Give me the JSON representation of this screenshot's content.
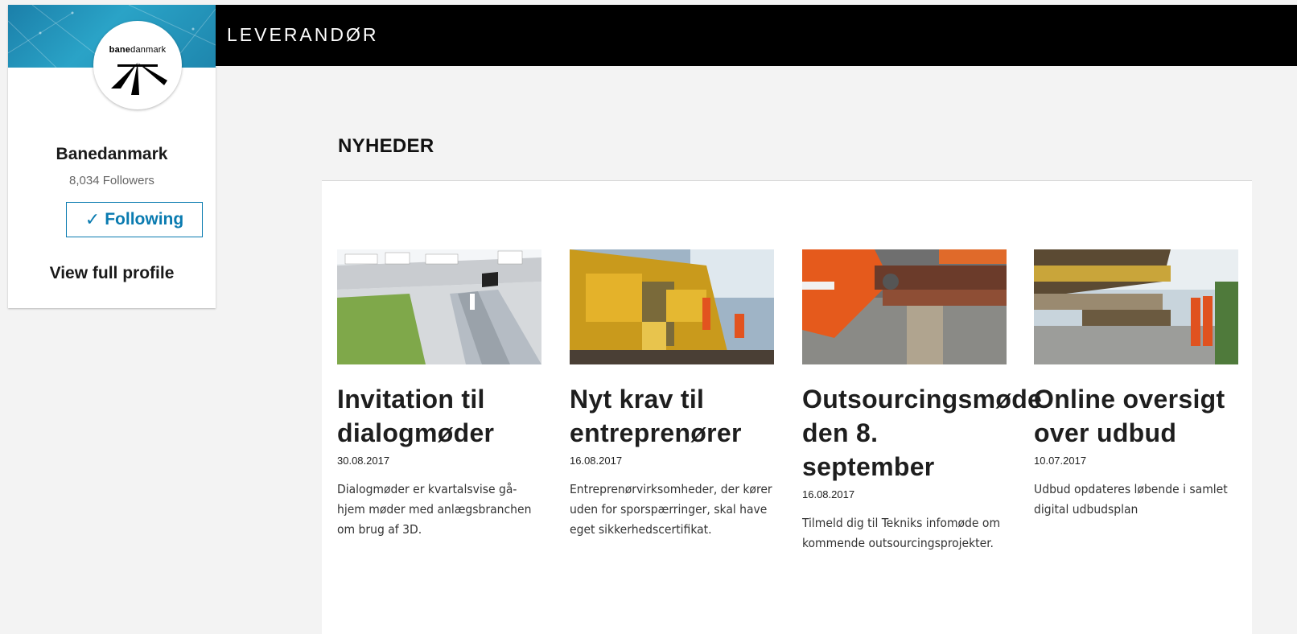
{
  "header": {
    "title": "LEVERANDØR"
  },
  "profile": {
    "logo_text_bold": "bane",
    "logo_text_regular": "danmark",
    "name": "Banedanmark",
    "followers": "8,034 Followers",
    "follow_button": {
      "check": "✓",
      "label": "Following"
    },
    "view_profile": "View full profile",
    "banner_color": "#1e8fb8"
  },
  "news": {
    "section_title": "NYHEDER",
    "items": [
      {
        "title": "Invitation til dialogmøder",
        "date": "30.08.2017",
        "text": "Dialogmøder er kvartalsvise gå-hjem møder med anlægsbranchen om brug af 3D."
      },
      {
        "title": "Nyt krav til entreprenører",
        "date": "16.08.2017",
        "text": "Entreprenørvirksomheder, der kører uden for sporspærringer, skal have eget sikkerhedscertifikat."
      },
      {
        "title": "Outsourcingsmøde den 8. september",
        "date": "16.08.2017",
        "text": "Tilmeld dig til Tekniks infomøde om kommende outsourcingsprojekter."
      },
      {
        "title": "Online oversigt over udbud",
        "date": "10.07.2017",
        "text": "Udbud opdateres løbende i samlet digital udbudsplan"
      }
    ]
  }
}
